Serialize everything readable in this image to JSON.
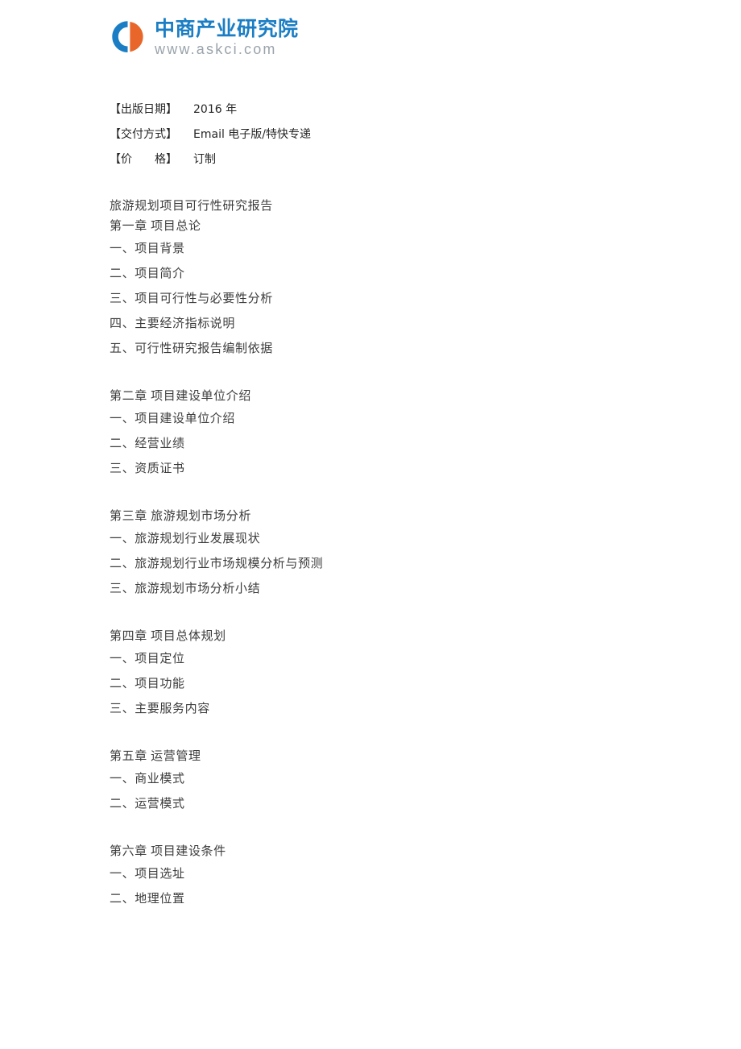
{
  "header": {
    "logo_icon": "askci-c-circle-logo",
    "company_name": "中商产业研究院",
    "website": "www.askci.com",
    "brand_blue": "#1b7ec4",
    "brand_orange": "#e8662a",
    "url_gray": "#9aa3ab"
  },
  "meta": {
    "rows": [
      {
        "key": "【出版日期】",
        "value": "2016 年"
      },
      {
        "key": "【交付方式】",
        "value": "Email 电子版/特快专递"
      },
      {
        "key": "【价　　格】",
        "value": "订制"
      }
    ]
  },
  "toc": {
    "doc_title": "旅游规划项目可行性研究报告",
    "sections": [
      {
        "chapter": "第一章  项目总论",
        "items": [
          "一、项目背景",
          "二、项目简介",
          "三、项目可行性与必要性分析",
          "四、主要经济指标说明",
          "五、可行性研究报告编制依据"
        ]
      },
      {
        "chapter": "第二章  项目建设单位介绍",
        "items": [
          "一、项目建设单位介绍",
          "二、经营业绩",
          "三、资质证书"
        ]
      },
      {
        "chapter": "第三章  旅游规划市场分析",
        "items": [
          "一、旅游规划行业发展现状",
          "二、旅游规划行业市场规模分析与预测",
          "三、旅游规划市场分析小结"
        ]
      },
      {
        "chapter": "第四章  项目总体规划",
        "items": [
          "一、项目定位",
          "二、项目功能",
          "三、主要服务内容"
        ]
      },
      {
        "chapter": "第五章  运营管理",
        "items": [
          "一、商业模式",
          "二、运营模式"
        ]
      },
      {
        "chapter": "第六章  项目建设条件",
        "items": [
          "一、项目选址",
          "二、地理位置"
        ]
      }
    ]
  }
}
